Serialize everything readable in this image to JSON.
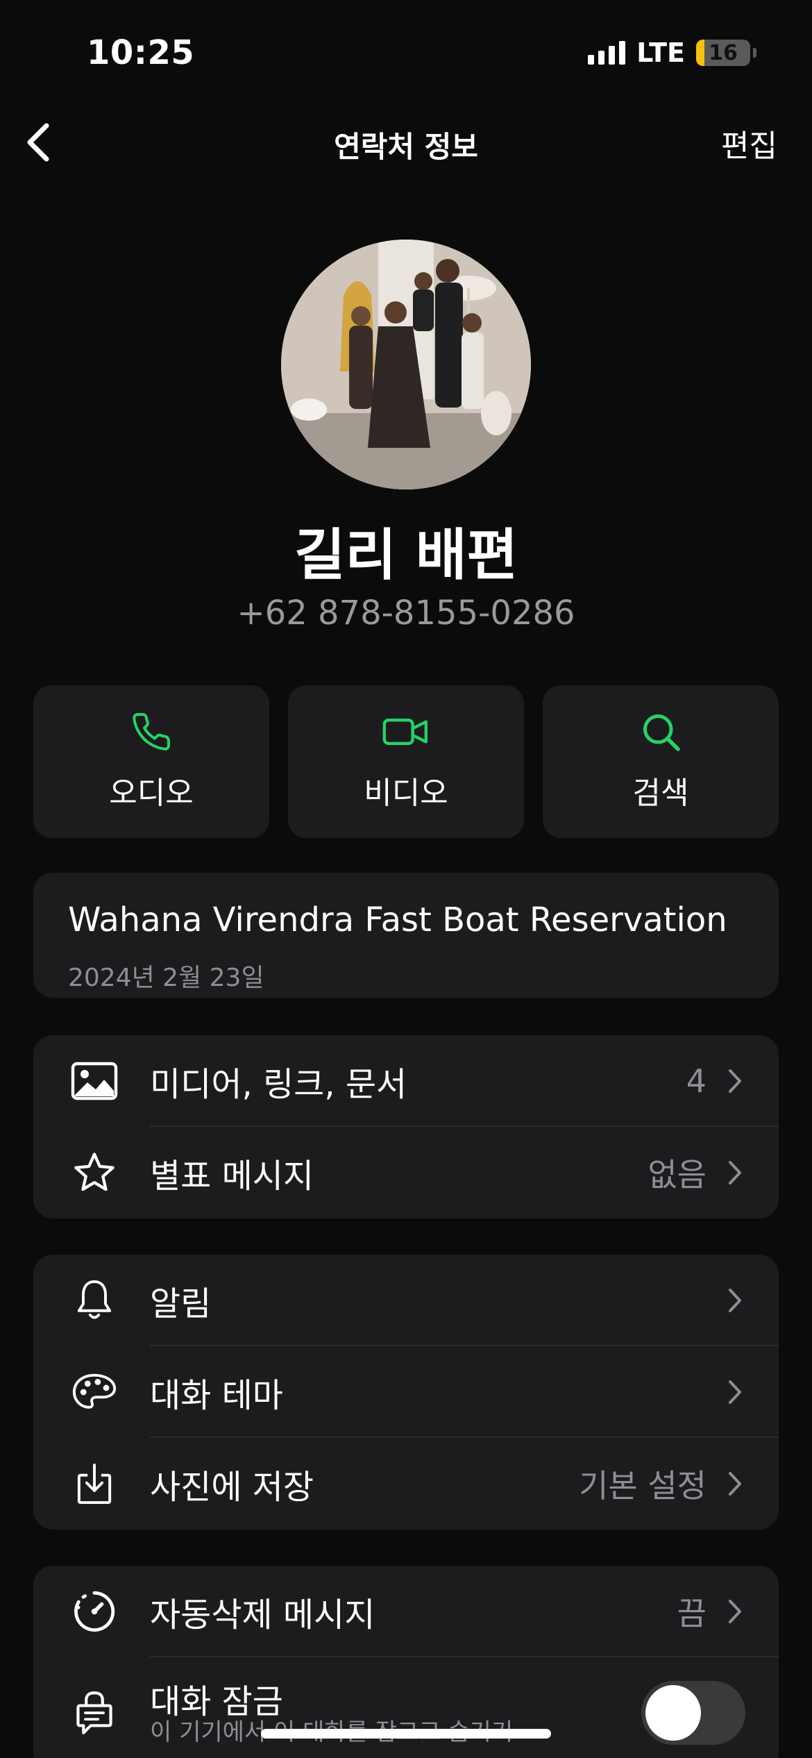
{
  "status_bar": {
    "time": "10:25",
    "network": "LTE",
    "battery_level": "16",
    "battery_fraction": 0.16,
    "battery_color": "#f4c20d"
  },
  "nav": {
    "title": "연락처 정보",
    "edit_label": "편집",
    "back_icon": "chevron-left-icon"
  },
  "contact": {
    "name": "길리 배편",
    "phone": "+62 878-8155-0286"
  },
  "actions": [
    {
      "label": "오디오",
      "icon": "phone-icon"
    },
    {
      "label": "비디오",
      "icon": "video-camera-icon"
    },
    {
      "label": "검색",
      "icon": "search-icon"
    }
  ],
  "accent_color": "#25d366",
  "about": {
    "text": "Wahana Virendra Fast Boat Reservation",
    "date": "2024년 2월 23일"
  },
  "section1": [
    {
      "label": "미디어, 링크, 문서",
      "value": "4",
      "icon": "image-icon"
    },
    {
      "label": "별표 메시지",
      "value": "없음",
      "icon": "star-icon"
    }
  ],
  "section2": [
    {
      "label": "알림",
      "value": "",
      "icon": "bell-icon"
    },
    {
      "label": "대화 테마",
      "value": "",
      "icon": "palette-icon"
    },
    {
      "label": "사진에 저장",
      "value": "기본 설정",
      "icon": "save-to-photos-icon"
    }
  ],
  "section3": [
    {
      "label": "자동삭제 메시지",
      "value": "끔",
      "icon": "timer-icon"
    },
    {
      "label": "대화 잠금",
      "subtitle": "이 기기에서 이 대화를 잠그고 숨기기",
      "toggle_on": false,
      "icon": "chat-lock-icon"
    }
  ]
}
